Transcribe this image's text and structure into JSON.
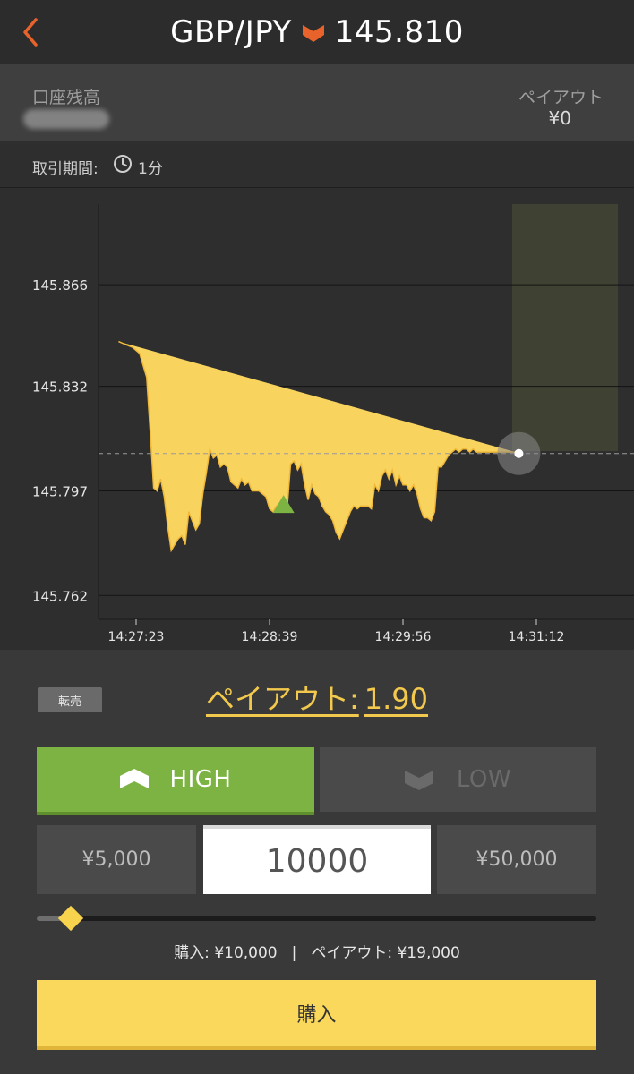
{
  "header": {
    "pair": "GBP/JPY",
    "price": "145.810",
    "icons": {
      "back": "chevron-left-icon",
      "direction": "arrow-down-icon"
    },
    "colors": {
      "direction": "#e8632b"
    }
  },
  "account": {
    "balance_label": "口座残高",
    "payout_label": "ペイアウト",
    "payout_value": "¥0"
  },
  "period": {
    "label": "取引期間:",
    "icon": "clock-icon",
    "value": "1分"
  },
  "chart_data": {
    "type": "area",
    "x_ticks": [
      "14:27:23",
      "14:28:39",
      "14:29:56",
      "14:31:12"
    ],
    "y_ticks": [
      "145.866",
      "145.832",
      "145.797",
      "145.762"
    ],
    "y_tick_values": [
      145.866,
      145.832,
      145.797,
      145.762
    ],
    "ylim": [
      145.754,
      145.893
    ],
    "current_price": 145.8095,
    "entry_marker": {
      "time_seconds": 84,
      "price": 145.792
    },
    "series": [
      {
        "x_seconds": [
          -10,
          -6,
          -2,
          2,
          6,
          8,
          10,
          12,
          14,
          16,
          18,
          20,
          22,
          24,
          26,
          28,
          30,
          32,
          34,
          36,
          38,
          40,
          42,
          44,
          46,
          48,
          50,
          52,
          54,
          56,
          58,
          60,
          62,
          64,
          66,
          68,
          70,
          72,
          74,
          76,
          78,
          80,
          82,
          84,
          86,
          88,
          90,
          92,
          94,
          96,
          98,
          100,
          102,
          104,
          106,
          108,
          110,
          112,
          114,
          116,
          118,
          120,
          122,
          124,
          126,
          128,
          130,
          132,
          134,
          136,
          138,
          140,
          142,
          144,
          146,
          148,
          150,
          152,
          154,
          156,
          158,
          160,
          162,
          164,
          166,
          168,
          170,
          172,
          174,
          176,
          178,
          180,
          182,
          184,
          186,
          188,
          190,
          192,
          194,
          196,
          198,
          200,
          202,
          204,
          206,
          208,
          210,
          212,
          214,
          216,
          218
        ],
        "values": [
          145.847,
          145.846,
          145.845,
          145.843,
          145.835,
          145.817,
          145.798,
          145.797,
          145.801,
          145.795,
          145.785,
          145.777,
          145.779,
          145.781,
          145.782,
          145.779,
          145.79,
          145.787,
          145.784,
          145.786,
          145.796,
          145.803,
          145.811,
          145.808,
          145.809,
          145.805,
          145.806,
          145.805,
          145.8,
          145.799,
          145.798,
          145.801,
          145.799,
          145.8,
          145.797,
          145.797,
          145.797,
          145.796,
          145.795,
          145.791,
          145.79,
          145.792,
          145.793,
          145.792,
          145.791,
          145.806,
          145.807,
          145.804,
          145.806,
          145.799,
          145.794,
          145.799,
          145.796,
          145.795,
          145.792,
          145.79,
          145.789,
          145.787,
          145.783,
          145.781,
          145.784,
          145.787,
          145.79,
          145.792,
          145.791,
          145.792,
          145.792,
          145.792,
          145.791,
          145.799,
          145.797,
          145.802,
          145.804,
          145.801,
          145.804,
          145.799,
          145.802,
          145.799,
          145.799,
          145.797,
          145.799,
          145.796,
          145.791,
          145.788,
          145.788,
          145.787,
          145.79,
          145.805,
          145.805,
          145.807,
          145.809,
          145.81,
          145.811,
          145.81,
          145.811,
          145.811,
          145.81,
          145.811,
          145.81,
          145.81,
          145.81,
          145.81,
          145.81,
          145.81,
          145.81,
          145.81,
          145.81,
          145.81,
          145.81,
          145.81
        ]
      }
    ],
    "colors": {
      "fill": "#f8d35e",
      "line": "#f0b93a",
      "entry_marker": "#7cb342",
      "expiry_zone": "#3f4232"
    }
  },
  "controls": {
    "resell_label": "転売",
    "payout_rate_label": "ペイアウト:",
    "payout_rate_value": "1.90",
    "high_label": "HIGH",
    "low_label": "LOW",
    "amount_presets": [
      "¥5,000",
      "¥50,000"
    ],
    "amount_value": "10000",
    "slider_level": 0.06,
    "summary": {
      "purchase": "購入: ¥10,000",
      "separator": "|",
      "payout": "ペイアウト: ¥19,000"
    },
    "buy_label": "購入",
    "icons": {
      "high": "arrow-up-icon",
      "low": "arrow-down-icon"
    },
    "colors": {
      "high": "#7cb342",
      "low": "#4a4a4a",
      "buy": "#f9d85c",
      "accent": "#f2c94c"
    }
  }
}
